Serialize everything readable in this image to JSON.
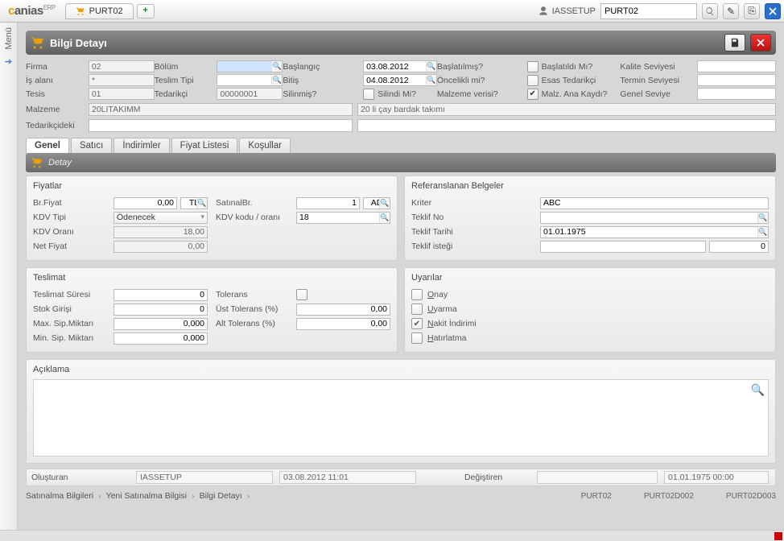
{
  "app": {
    "brand_c": "c",
    "brand_rest": "anias",
    "brand_sup": "ERP",
    "tab_label": "PURT02",
    "user": "IASSETUP",
    "search_value": "PURT02"
  },
  "left_rail": {
    "label": "Menü"
  },
  "module": {
    "title": "Bilgi Detayı"
  },
  "hdr": {
    "firma_lbl": "Firma",
    "firma": "02",
    "bolum_lbl": "Bölüm",
    "bolum": "",
    "baslangic_lbl": "Başlangıç",
    "baslangic": "03.08.2012",
    "baslatilmis_lbl": "Başlatılmış?",
    "baslatildi_mi_lbl": "Başlatıldı Mı?",
    "kalite_lbl": "Kalite Seviyesi",
    "isalani_lbl": "İş alanı",
    "isalani": "*",
    "teslimtipi_lbl": "Teslim Tipi",
    "teslimtipi": "",
    "bitis_lbl": "Bitiş",
    "bitis": "04.08.2012",
    "oncelikli_lbl": "Öncelikli mi?",
    "esas_tedarikci_lbl": "Esas Tedarikçi",
    "termin_lbl": "Termin Seviyesi",
    "tesis_lbl": "Tesis",
    "tesis": "01",
    "tedarikci_lbl": "Tedarikçi",
    "tedarikci": "00000001",
    "silinmis_lbl": "Silinmiş?",
    "silindi_mi_lbl": "Silindi Mi?",
    "malzeme_verisi_lbl": "Malzeme verisi?",
    "malz_ana_lbl": "Malz. Ana Kaydı?",
    "genel_seviye_lbl": "Genel Seviye",
    "malzeme_lbl": "Malzeme",
    "malzeme": "20LITAKIMM",
    "malzeme_desc": "20 li çay bardak takımı",
    "tedarikcideki_lbl": "Tedarikçideki"
  },
  "tabs": {
    "genel": "Genel",
    "satici": "Satıcı",
    "indirimler": "İndirimler",
    "fiyat_listesi": "Fiyat Listesi",
    "kosullar": "Koşullar"
  },
  "detail_strip": "Detay",
  "fiyatlar": {
    "title": "Fiyatlar",
    "brfiyat_lbl": "Br.Fiyat",
    "brfiyat": "0,00",
    "brfiyat_unit": "TL",
    "satinalbr_lbl": "SatınalBr.",
    "satinalbr": "1",
    "satinalbr_unit": "AD",
    "kdvtipi_lbl": "KDV Tipi",
    "kdvtipi": "Ödenecek",
    "kdvkodu_lbl": "KDV kodu / oranı",
    "kdvkodu": "18",
    "kdvorani_lbl": "KDV Oranı",
    "kdvorani": "18,00",
    "netfiyat_lbl": "Net Fiyat",
    "netfiyat": "0,00"
  },
  "teslimat": {
    "title": "Teslimat",
    "suresi_lbl": "Teslimat Süresi",
    "suresi": "0",
    "tolerans_lbl": "Tolerans",
    "stok_lbl": "Stok Girişi",
    "stok": "0",
    "usttol_lbl": "Üst Tolerans (%)",
    "usttol": "0,00",
    "max_lbl": "Max. Sip.Miktarı",
    "max": "0,000",
    "alttol_lbl": "Alt Tolerans (%)",
    "alttol": "0,00",
    "min_lbl": "Min. Sip. Miktarı",
    "min": "0,000"
  },
  "ref": {
    "title": "Referanslanan Belgeler",
    "kriter_lbl": "Kriter",
    "kriter": "ABC",
    "teklifno_lbl": "Teklif No",
    "teklifno": "",
    "tekliftarihi_lbl": "Teklif Tarihi",
    "tekliftarihi": "01.01.1975",
    "teklifistegi_lbl": "Teklif isteği",
    "teklifistegi_a": "",
    "teklifistegi_b": "0"
  },
  "uyarilar": {
    "title": "Uyarılar",
    "onay": "Onay",
    "uyarma": "Uyarma",
    "nakit": "Nakit İndirimi",
    "hatirlatma": "Hatırlatma"
  },
  "aciklama": {
    "title": "Açıklama"
  },
  "meta": {
    "olusturan_lbl": "Oluşturan",
    "olusturan": "IASSETUP",
    "olusturan_t": "03.08.2012 11:01",
    "degistiren_lbl": "Değiştiren",
    "degistiren": "",
    "degistiren_t": "01.01.1975 00:00"
  },
  "crumbs": {
    "a": "Satınalma Bilgileri",
    "b": "Yeni Satınalma Bilgisi",
    "c": "Bilgi Detayı"
  },
  "status_right": {
    "a": "PURT02",
    "b": "PURT02D002",
    "c": "PURT02D003"
  }
}
